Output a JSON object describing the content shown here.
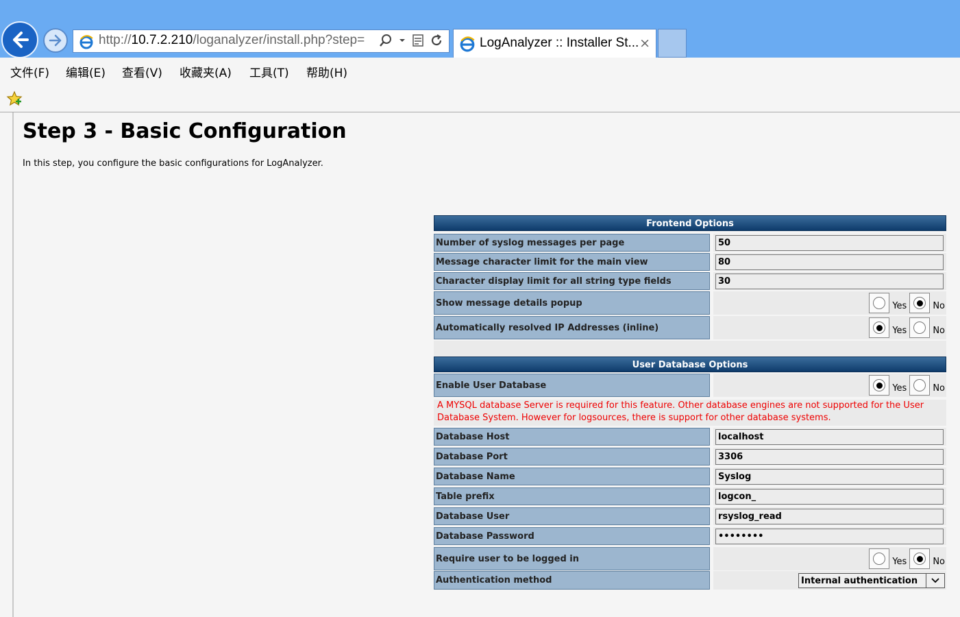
{
  "browser": {
    "url_prefix": "http://",
    "url_host": "10.7.2.210",
    "url_path": "/loganalyzer/install.php?step=",
    "tab_title": "LogAnalyzer :: Installer St...",
    "tab_close": "×"
  },
  "menu": [
    "文件(F)",
    "编辑(E)",
    "查看(V)",
    "收藏夹(A)",
    "工具(T)",
    "帮助(H)"
  ],
  "page": {
    "title": "Step 3 - Basic Configuration",
    "intro": "In this step, you configure the basic configurations for LogAnalyzer."
  },
  "frontend": {
    "header": "Frontend Options",
    "rows": [
      {
        "label": "Number of syslog messages per page",
        "value": "50"
      },
      {
        "label": "Message character limit for the main view",
        "value": "80"
      },
      {
        "label": "Character display limit for all string type fields",
        "value": "30"
      }
    ],
    "popup": {
      "label": "Show message details popup",
      "yes": "Yes",
      "no": "No",
      "selected": "no"
    },
    "resolve": {
      "label": "Automatically resolved IP Addresses (inline)",
      "yes": "Yes",
      "no": "No",
      "selected": "yes"
    }
  },
  "userdb": {
    "header": "User Database Options",
    "enable": {
      "label": "Enable User Database",
      "yes": "Yes",
      "no": "No",
      "selected": "yes"
    },
    "warning": "A MYSQL database Server is required for this feature. Other database engines are not supported for the User Database System. However for logsources, there is support for other database systems.",
    "rows": [
      {
        "label": "Database Host",
        "value": "localhost"
      },
      {
        "label": "Database Port",
        "value": "3306"
      },
      {
        "label": "Database Name",
        "value": "Syslog"
      },
      {
        "label": "Table prefix",
        "value": "logcon_"
      },
      {
        "label": "Database User",
        "value": "rsyslog_read"
      },
      {
        "label": "Database Password",
        "value": "••••••••"
      }
    ],
    "login": {
      "label": "Require user to be logged in",
      "yes": "Yes",
      "no": "No",
      "selected": "no"
    },
    "auth": {
      "label": "Authentication method",
      "value": "Internal authentication"
    }
  }
}
